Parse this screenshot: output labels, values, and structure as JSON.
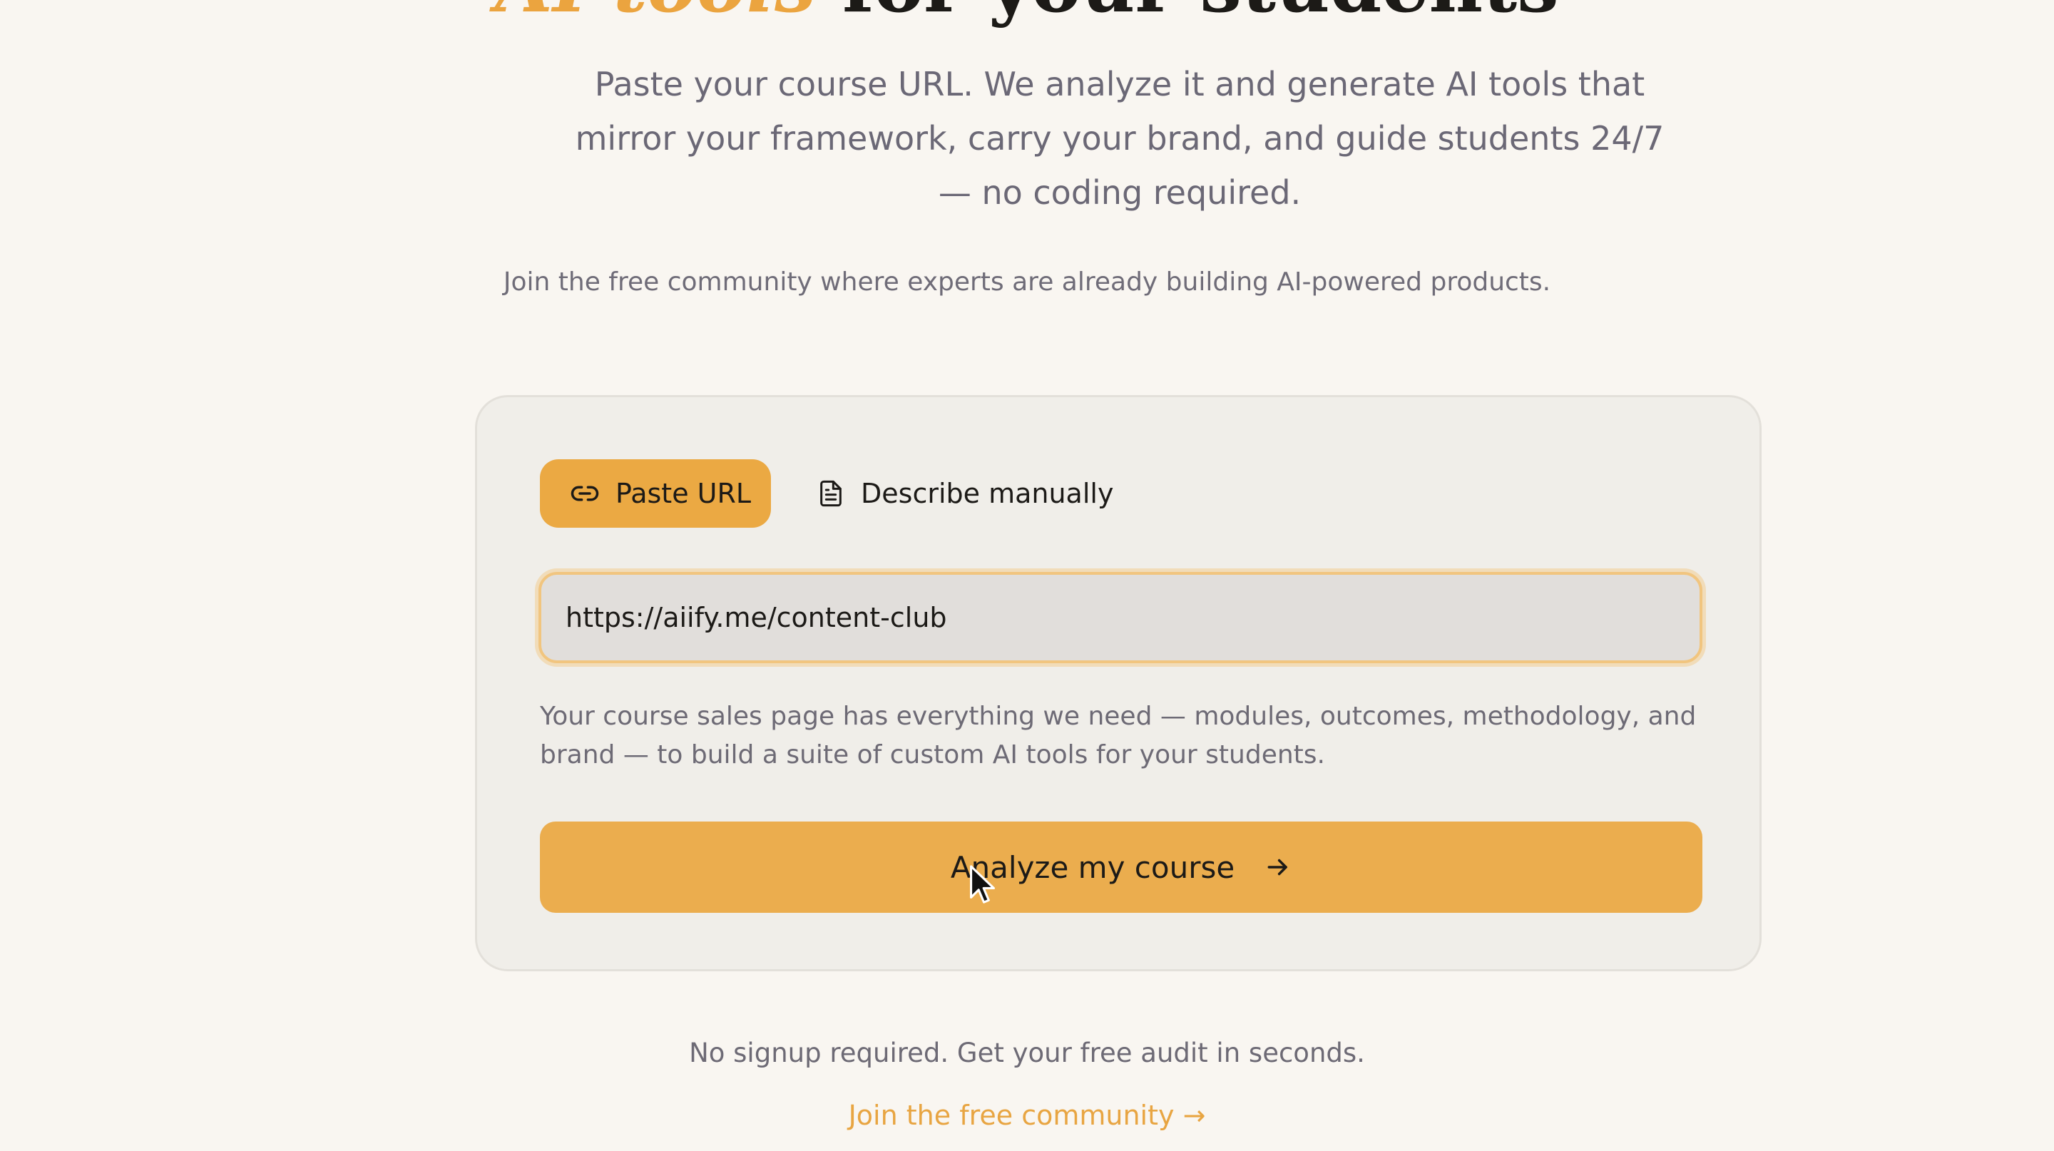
{
  "hero": {
    "title_accent": "AI tools",
    "title_rest": " for your students",
    "subtitle": "Paste your course URL. We analyze it and generate AI tools that mirror your framework, carry your brand, and guide students 24/7 — no coding required.",
    "community_line": "Join the free community where experts are already building AI-powered products."
  },
  "card": {
    "tabs": [
      {
        "label": "Paste URL",
        "icon": "link-icon",
        "active": true
      },
      {
        "label": "Describe manually",
        "icon": "document-icon",
        "active": false
      }
    ],
    "url_input": {
      "value": "https://aiify.me/content-club",
      "placeholder": ""
    },
    "helper_text": "Your course sales page has everything we need — modules, outcomes, methodology, and brand — to build a suite of custom AI tools for your students.",
    "cta": {
      "label": "Analyze my course",
      "icon": "arrow-right-icon"
    }
  },
  "footer": {
    "no_signup": "No signup required. Get your free audit in seconds.",
    "join_link": "Join the free community →"
  },
  "colors": {
    "background": "#f9f6f1",
    "accent": "#eba43f",
    "card_background": "#f0eee9",
    "input_background": "#e1dedb",
    "text_dark": "#1c1a17",
    "text_muted": "#6b6876"
  }
}
